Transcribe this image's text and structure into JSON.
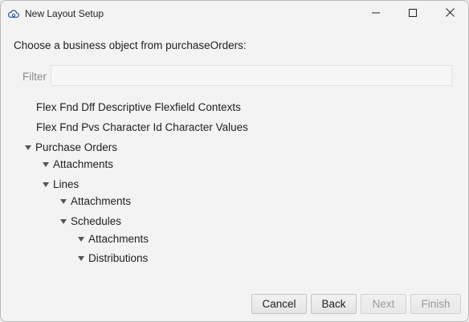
{
  "window": {
    "title": "New Layout Setup"
  },
  "heading": "Choose a business object from purchaseOrders:",
  "filter": {
    "label": "Filter",
    "value": "",
    "placeholder": ""
  },
  "tree": {
    "items": [
      {
        "label": "Flex Fnd Dff Descriptive Flexfield Contexts",
        "level": 0,
        "expandable": false
      },
      {
        "label": "Flex Fnd Pvs Character Id Character Values",
        "level": 0,
        "expandable": false
      },
      {
        "label": "Purchase Orders",
        "level": 0,
        "expandable": true,
        "expanded": true
      },
      {
        "label": "Attachments",
        "level": 1,
        "expandable": true,
        "expanded": true
      },
      {
        "label": "Lines",
        "level": 1,
        "expandable": true,
        "expanded": true
      },
      {
        "label": "Attachments",
        "level": 2,
        "expandable": true,
        "expanded": true
      },
      {
        "label": "Schedules",
        "level": 2,
        "expandable": true,
        "expanded": true
      },
      {
        "label": "Attachments",
        "level": 3,
        "expandable": true,
        "expanded": true
      },
      {
        "label": "Distributions",
        "level": 3,
        "expandable": true,
        "expanded": true
      }
    ]
  },
  "buttons": {
    "cancel": "Cancel",
    "back": "Back",
    "next": "Next",
    "finish": "Finish"
  },
  "icons": {
    "app": "cloud-gear-icon",
    "minimize": "minimize-icon",
    "maximize": "maximize-icon",
    "close": "close-icon",
    "expand": "triangle-down-icon"
  }
}
